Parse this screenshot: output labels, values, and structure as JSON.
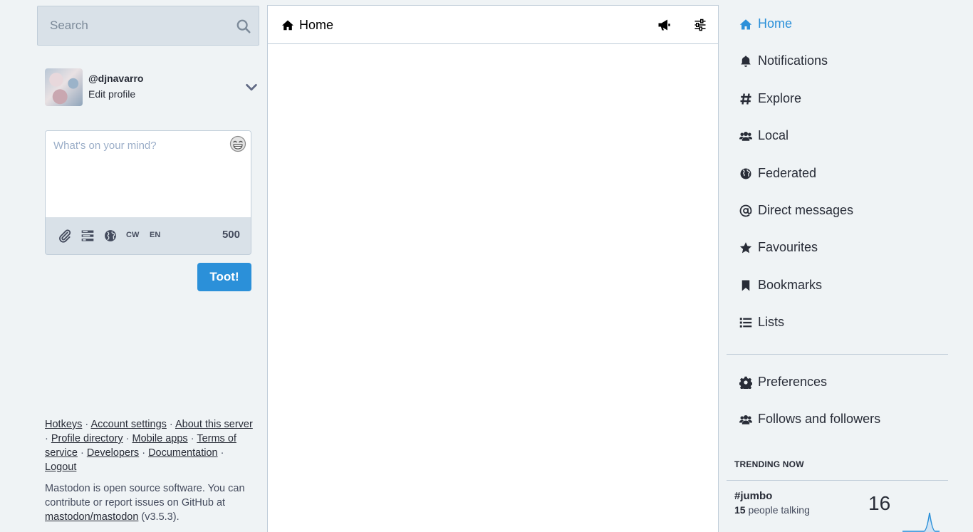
{
  "search": {
    "placeholder": "Search"
  },
  "account": {
    "handle": "@djnavarro",
    "edit_label": "Edit profile"
  },
  "compose": {
    "placeholder": "What's on your mind?",
    "cw_label": "CW",
    "lang_label": "EN",
    "char_count": "500",
    "submit_label": "Toot!"
  },
  "footer": {
    "links": {
      "hotkeys": "Hotkeys",
      "account_settings": "Account settings",
      "about_server": "About this server",
      "profile_directory": "Profile directory",
      "mobile_apps": "Mobile apps",
      "terms": "Terms of service",
      "developers": "Developers",
      "documentation": "Documentation",
      "logout": "Logout"
    },
    "sep": "·",
    "about_text_1": "Mastodon is open source software. You can contribute or report issues on GitHub at ",
    "repo_link": "mastodon/mastodon",
    "version": " (v3.5.3)."
  },
  "column": {
    "title": "Home"
  },
  "nav": {
    "items": [
      {
        "label": "Home",
        "icon": "home-icon",
        "active": true
      },
      {
        "label": "Notifications",
        "icon": "bell-icon"
      },
      {
        "label": "Explore",
        "icon": "hashtag-icon"
      },
      {
        "label": "Local",
        "icon": "users-icon"
      },
      {
        "label": "Federated",
        "icon": "globe-icon"
      },
      {
        "label": "Direct messages",
        "icon": "at-icon"
      },
      {
        "label": "Favourites",
        "icon": "star-icon"
      },
      {
        "label": "Bookmarks",
        "icon": "bookmark-icon"
      },
      {
        "label": "Lists",
        "icon": "list-icon"
      }
    ],
    "secondary": [
      {
        "label": "Preferences",
        "icon": "gear-icon"
      },
      {
        "label": "Follows and followers",
        "icon": "users-icon"
      }
    ]
  },
  "trending": {
    "title": "TRENDING NOW",
    "items": [
      {
        "tag": "#jumbo",
        "people": "15",
        "people_suffix": " people talking",
        "count": "16"
      }
    ]
  },
  "colors": {
    "accent": "#2b90d9",
    "background": "#eff3f5",
    "panel": "#d9e1e8"
  }
}
